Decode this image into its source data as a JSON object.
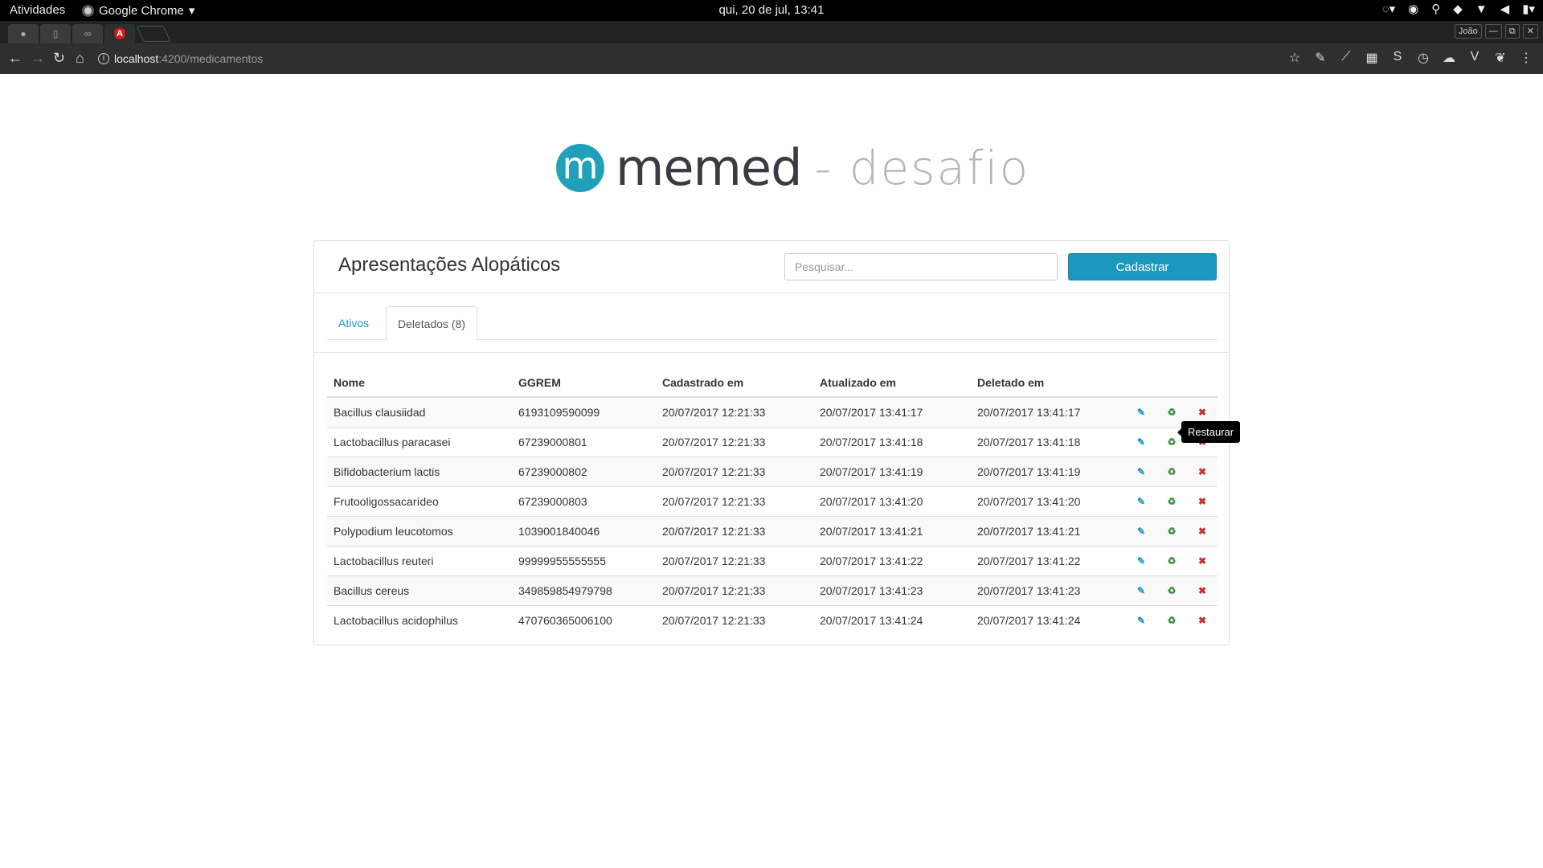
{
  "os_bar": {
    "activities": "Atividades",
    "app_name": "Google Chrome",
    "clock": "qui, 20 de jul, 13:41"
  },
  "browser": {
    "profile": "João",
    "url_host": "localhost",
    "url_path": ":4200/medicamentos"
  },
  "logo": {
    "letter": "m",
    "word": "memed",
    "sub": "- desafio",
    "brand_color": "#21a1b9"
  },
  "panel": {
    "title": "Apresentações Alopáticos",
    "search_placeholder": "Pesquisar...",
    "register_button": "Cadastrar"
  },
  "tabs": {
    "active_label": "Ativos",
    "deleted_label": "Deletados (8)"
  },
  "table": {
    "headers": [
      "Nome",
      "GGREM",
      "Cadastrado em",
      "Atualizado em",
      "Deletado em"
    ],
    "rows": [
      [
        "Bacillus clausiidad",
        "6193109590099",
        "20/07/2017 12:21:33",
        "20/07/2017 13:41:17",
        "20/07/2017 13:41:17"
      ],
      [
        "Lactobacillus paracasei",
        "67239000801",
        "20/07/2017 12:21:33",
        "20/07/2017 13:41:18",
        "20/07/2017 13:41:18"
      ],
      [
        "Bifidobacterium lactis",
        "67239000802",
        "20/07/2017 12:21:33",
        "20/07/2017 13:41:19",
        "20/07/2017 13:41:19"
      ],
      [
        "Frutooligossacarídeo",
        "67239000803",
        "20/07/2017 12:21:33",
        "20/07/2017 13:41:20",
        "20/07/2017 13:41:20"
      ],
      [
        "Polypodium leucotomos",
        "1039001840046",
        "20/07/2017 12:21:33",
        "20/07/2017 13:41:21",
        "20/07/2017 13:41:21"
      ],
      [
        "Lactobacillus reuteri",
        "99999955555555",
        "20/07/2017 12:21:33",
        "20/07/2017 13:41:22",
        "20/07/2017 13:41:22"
      ],
      [
        "Bacillus cereus",
        "349859854979798",
        "20/07/2017 12:21:33",
        "20/07/2017 13:41:23",
        "20/07/2017 13:41:23"
      ],
      [
        "Lactobacillus acidophilus",
        "470760365006100",
        "20/07/2017 12:21:33",
        "20/07/2017 13:41:24",
        "20/07/2017 13:41:24"
      ]
    ],
    "action_icons": [
      "edit-icon",
      "restore-icon",
      "delete-icon"
    ]
  },
  "tooltip": "Restaurar"
}
